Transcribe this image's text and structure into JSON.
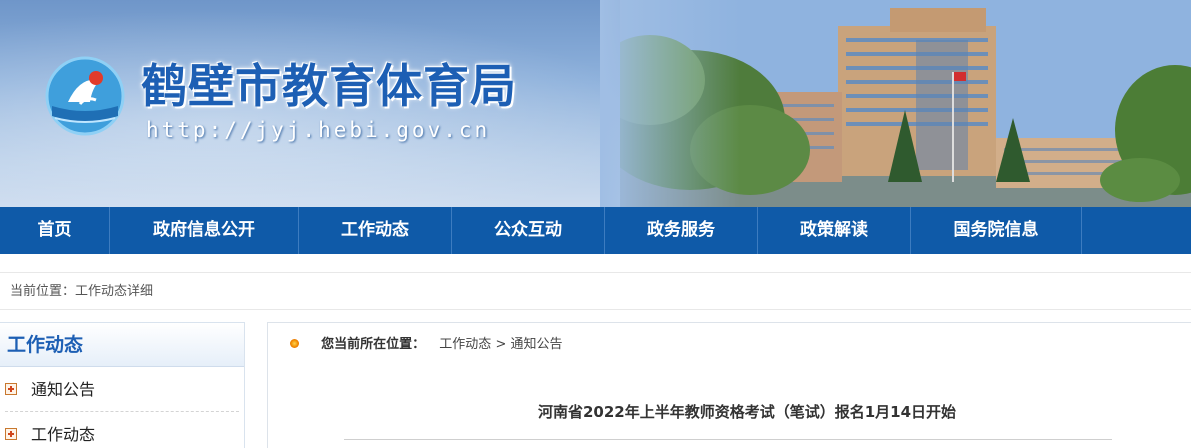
{
  "header": {
    "site_title": "鹤壁市教育体育局",
    "site_url": "http://jyj.hebi.gov.cn",
    "logo_icon": "crane-emblem-icon",
    "banner_photo": "government-building-photo"
  },
  "nav": {
    "items": [
      {
        "label": "首页"
      },
      {
        "label": "政府信息公开"
      },
      {
        "label": "工作动态"
      },
      {
        "label": "公众互动"
      },
      {
        "label": "政务服务"
      },
      {
        "label": "政策解读"
      },
      {
        "label": "国务院信息"
      }
    ]
  },
  "location_bar": {
    "text": "当前位置：工作动态详细"
  },
  "sidebar": {
    "heading": "工作动态",
    "items": [
      {
        "label": "通知公告",
        "icon": "plus-box-icon"
      },
      {
        "label": "工作动态",
        "icon": "plus-box-icon"
      }
    ]
  },
  "content": {
    "position_label": "您当前所在位置：",
    "crumb_parent": "工作动态",
    "crumb_separator": ">",
    "crumb_current": "通知公告",
    "article_title": "河南省2022年上半年教师资格考试（笔试）报名1月14日开始"
  },
  "colors": {
    "nav_bg": "#0f5aa8",
    "title_blue": "#1d5fb4",
    "bullet_orange": "#f08a00"
  }
}
